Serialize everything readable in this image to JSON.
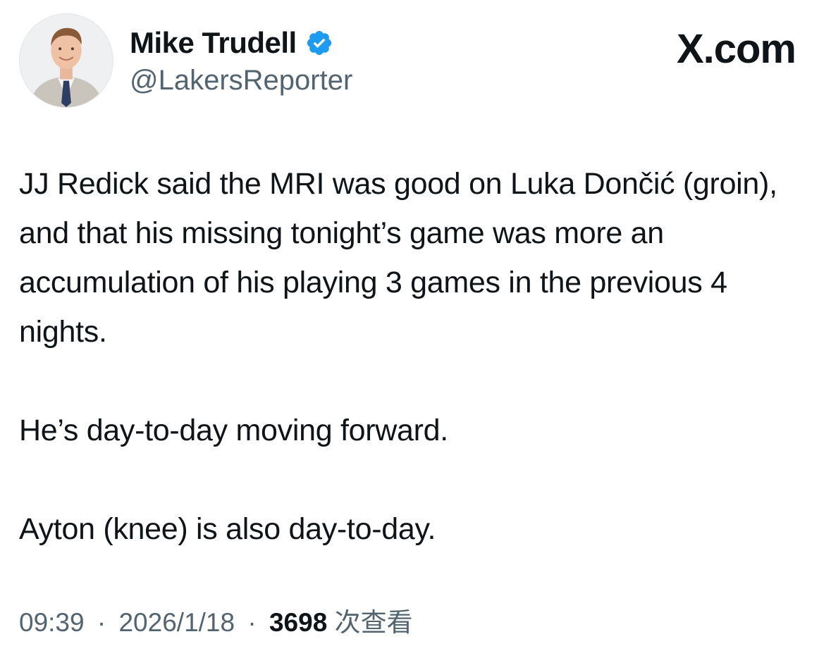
{
  "author": {
    "display_name": "Mike Trudell",
    "handle": "@LakersReporter",
    "verified_icon": "verified-badge-icon",
    "verified_color": "#1d9bf0"
  },
  "brand": {
    "label": "X.com"
  },
  "tweet": {
    "paragraphs": [
      "JJ Redick said the MRI was good on Luka Dončić (groin), and that his missing tonight’s game was more an accumulation of his playing 3 games in the previous 4 nights.",
      "He’s day-to-day moving forward.",
      "Ayton (knee) is also day-to-day."
    ]
  },
  "meta": {
    "time": "09:39",
    "separator": "·",
    "date": "2026/1/18",
    "views_count": "3698",
    "views_label": "次查看"
  },
  "colors": {
    "text_primary": "#0f1419",
    "text_secondary": "#536471",
    "background": "#ffffff"
  }
}
